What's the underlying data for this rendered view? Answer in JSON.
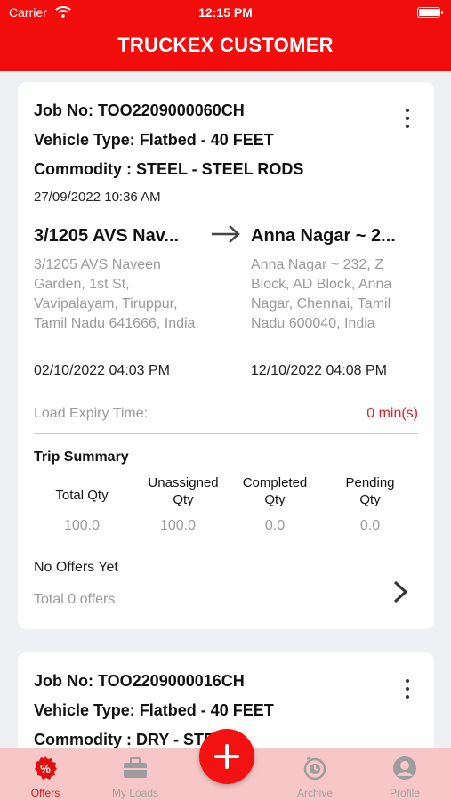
{
  "status_bar": {
    "carrier": "Carrier",
    "time": "12:15 PM"
  },
  "header": {
    "title": "TRUCKEX CUSTOMER"
  },
  "jobs": [
    {
      "job_no": "Job No: TOO2209000060CH",
      "vehicle_type": "Vehicle Type: Flatbed - 40 FEET",
      "commodity": "Commodity : STEEL - STEEL RODS",
      "created": "27/09/2022 10:36 AM",
      "from_title": "3/1205 AVS Nav...",
      "from_address": "3/1205 AVS Naveen Garden, 1st St, Vavipalayam, Tiruppur, Tamil Nadu 641666, India",
      "from_date": "02/10/2022 04:03 PM",
      "to_title": "Anna Nagar ~ 2...",
      "to_address": "Anna Nagar ~ 232, Z Block, AD Block, Anna Nagar, Chennai, Tamil Nadu 600040, India",
      "to_date": "12/10/2022 04:08 PM",
      "expiry_label": "Load Expiry Time:",
      "expiry_value": "0 min(s)",
      "trip_summary_title": "Trip Summary",
      "summary_headers": [
        "Total Qty",
        "Unassigned Qty",
        "Completed Qty",
        "Pending Qty"
      ],
      "summary_values": [
        "100.0",
        "100.0",
        "0.0",
        "0.0"
      ],
      "offers_status": "No Offers Yet",
      "offers_count": "Total 0 offers"
    },
    {
      "job_no": "Job No: TOO2209000016CH",
      "vehicle_type": "Vehicle Type: Flatbed - 40 FEET",
      "commodity": "Commodity : DRY - STEEL"
    }
  ],
  "tabs": [
    {
      "label": "Offers",
      "icon": "percent-tag-icon",
      "active": true
    },
    {
      "label": "My Loads",
      "icon": "briefcase-icon",
      "active": false
    },
    {
      "label": "Archive",
      "icon": "archive-clock-icon",
      "active": false
    },
    {
      "label": "Profile",
      "icon": "person-icon",
      "active": false
    }
  ],
  "colors": {
    "brand_red": "#f20d0d",
    "tab_bar": "#f7c7c7",
    "expiry_red": "#e02020"
  }
}
